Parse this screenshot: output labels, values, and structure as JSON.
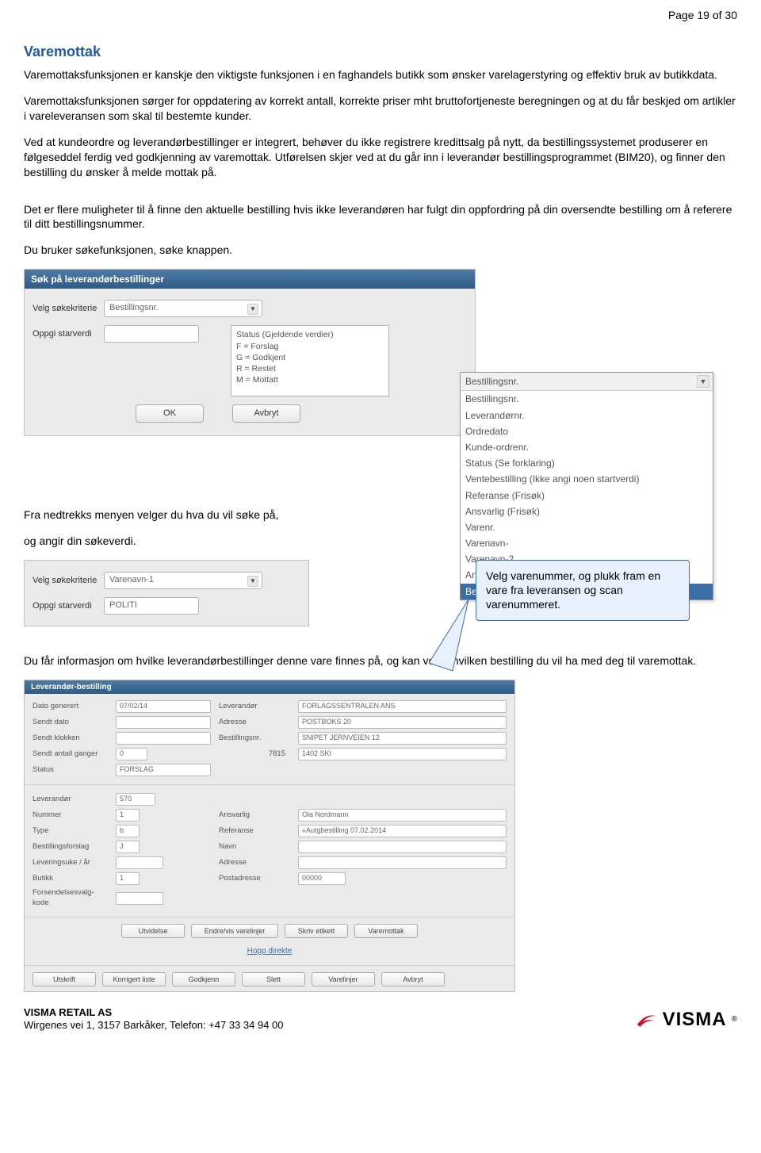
{
  "page_label": "Page 19 of 30",
  "section_title": "Varemottak",
  "paragraphs": {
    "p1": "Varemottaksfunksjonen er kanskje den viktigste funksjonen i en faghandels butikk som ønsker varelagerstyring og effektiv bruk av butikkdata.",
    "p2": "Varemottaksfunksjonen sørger for oppdatering av korrekt antall, korrekte priser mht bruttofortjeneste beregningen og at du får beskjed om artikler i vareleveransen som skal til bestemte kunder.",
    "p3": "Ved at kundeordre og leverandørbestillinger er integrert, behøver du ikke registrere kredittsalg på nytt, da bestillingssystemet produserer en følgeseddel ferdig ved godkjenning av varemottak. Utførelsen skjer ved at du går inn i leverandør bestillingsprogrammet (BIM20), og finner den bestilling du ønsker å melde mottak på.",
    "p4": "Det er flere muligheter til å finne den aktuelle bestilling hvis ikke leverandøren har fulgt din oppfordring på din oversendte bestilling om å referere til ditt bestillingsnummer.",
    "p5": "Du bruker søkefunksjonen, søke knappen.",
    "p6": "Fra nedtrekks menyen velger du hva du vil søke på,",
    "p7": "og angir din søkeverdi.",
    "p8": "Du får informasjon om hvilke leverandørbestillinger denne vare finnes på, og kan velge hvilken bestilling du vil ha med deg til varemottak."
  },
  "dialog1": {
    "title": "Søk på leverandørbestillinger",
    "label_criteria": "Velg søkekriterie",
    "criteria_value": "Bestillingsnr.",
    "label_start": "Oppgi starverdi",
    "status_legend": "Status (Gjeldende verdier)\nF = Forslag\nG = Godkjent\nR = Restet\nM = Mottatt",
    "btn_ok": "OK",
    "btn_cancel": "Avbryt"
  },
  "dropdown": {
    "header": "Bestillingsnr.",
    "items": [
      "Bestillingsnr.",
      "Leverandørnr.",
      "Ordredato",
      "Kunde-ordrenr.",
      "Status (Se forklaring)",
      "Ventebestilling (Ikke angi noen startverdi)",
      "Referanse (Frisøk)",
      "Ansvarlig (Frisøk)",
      "Varenr.",
      "Varenavn-",
      "Varenavn-2",
      "Artikkel",
      "Bestnr. - linje"
    ],
    "selected_index": 12
  },
  "dialog2": {
    "label_criteria": "Velg søkekriterie",
    "criteria_value": "Varenavn-1",
    "label_start": "Oppgi starverdi",
    "start_value": "POLITI"
  },
  "callout_text": "Velg varenummer, og plukk fram en vare fra leveransen og scan varenummeret.",
  "dialog3": {
    "title": "Leverandør-bestilling",
    "rows_top_left_labels": [
      "Dato generert",
      "Sendt dato",
      "Sendt klokken",
      "Sendt antall ganger",
      "Status"
    ],
    "rows_top_left_values": [
      "07/02/14",
      "",
      "",
      "0",
      "FORSLAG"
    ],
    "rows_top_right_labels": [
      "Leverandør",
      "Adresse",
      "Bestillingsnr."
    ],
    "rows_top_right_values": [
      "FORLAGSSENTRALEN ANS",
      "POSTBOKS 20",
      "SNIPET JERNVEIEN 12",
      "1402 SKI"
    ],
    "bestillingsnr": "7815",
    "rows_mid_left_labels": [
      "Leverandør",
      "Nummer",
      "Type",
      "Bestillingsforslag",
      "Leveringsuke / år",
      "Butikk",
      "Forsendelsesvalg-kode"
    ],
    "rows_mid_left_values": [
      "570",
      "1",
      "b",
      "J",
      "",
      "1",
      ""
    ],
    "rows_mid_right_labels": [
      "Ansvarlig",
      "Referanse",
      "Navn",
      "Adresse",
      "Postadresse"
    ],
    "rows_mid_right_values": [
      "Ola Nordmann",
      "«Autgbestilling 07.02.2014",
      "",
      "",
      "00000"
    ],
    "btns1": [
      "Utvidelse",
      "Endre/vis varelinjer",
      "Skriv etikett",
      "Varemottak"
    ],
    "link": "Hopp direkte",
    "btns2": [
      "Utskrift",
      "Korrigert liste",
      "Godkjenn",
      "Slett",
      "Varelinjer",
      "Avbryt"
    ]
  },
  "footer": {
    "company": "VISMA RETAIL AS",
    "address": "Wirgenes vei 1, 3157 Barkåker, Telefon: +47 33 34 94 00",
    "logo_text": "VISMA"
  }
}
